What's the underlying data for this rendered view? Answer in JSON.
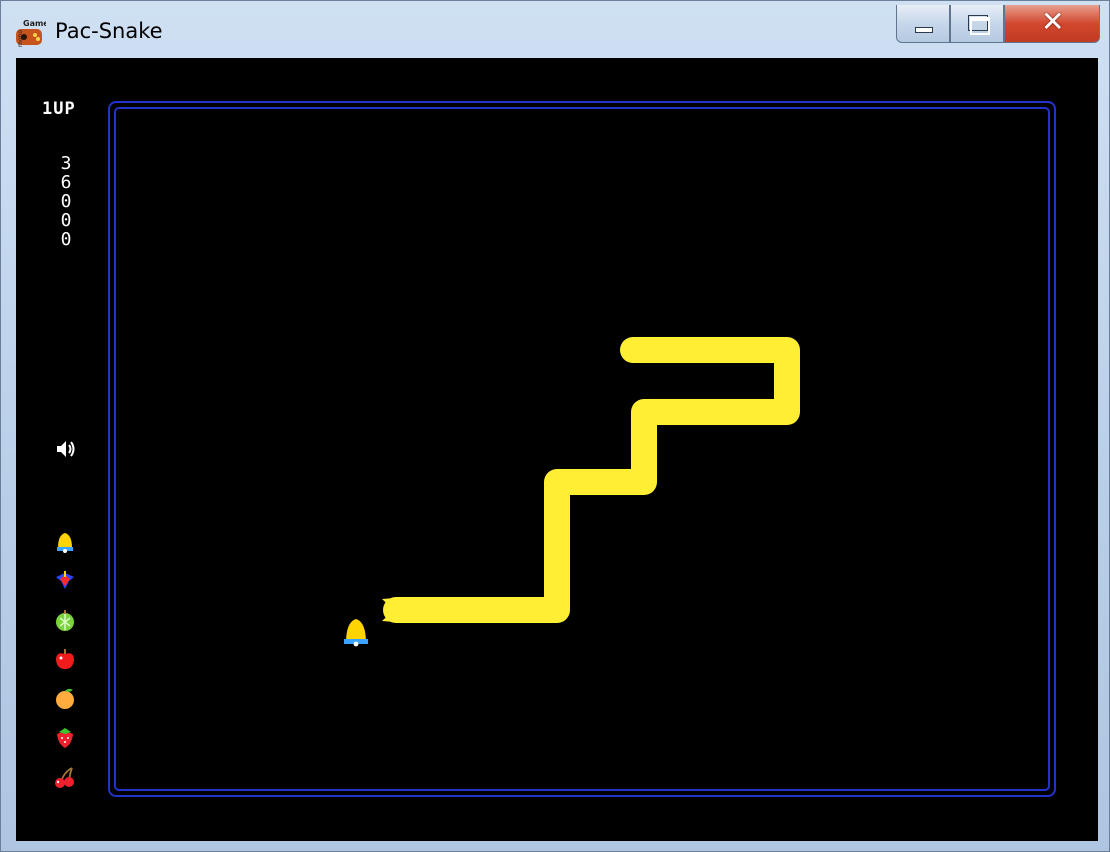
{
  "window": {
    "title": "Pac-Snake",
    "app_icon": "monogame-logo-icon",
    "controls": {
      "minimize": "minimize-icon",
      "maximize": "maximize-icon",
      "close_label": "✕"
    }
  },
  "hud": {
    "player_label": "1UP",
    "score_digits": [
      "3",
      "6",
      "0",
      "0",
      "0"
    ],
    "sound_icon": "speaker-icon",
    "fruit_collection": [
      "bell",
      "galaxian",
      "melon",
      "apple",
      "orange",
      "strawberry",
      "cherry"
    ]
  },
  "colors": {
    "snake": "#ffee33",
    "maze_border": "#2233cc",
    "background": "#000000",
    "hud_text": "#ffffff",
    "titlebar_close": "#c8402a"
  }
}
